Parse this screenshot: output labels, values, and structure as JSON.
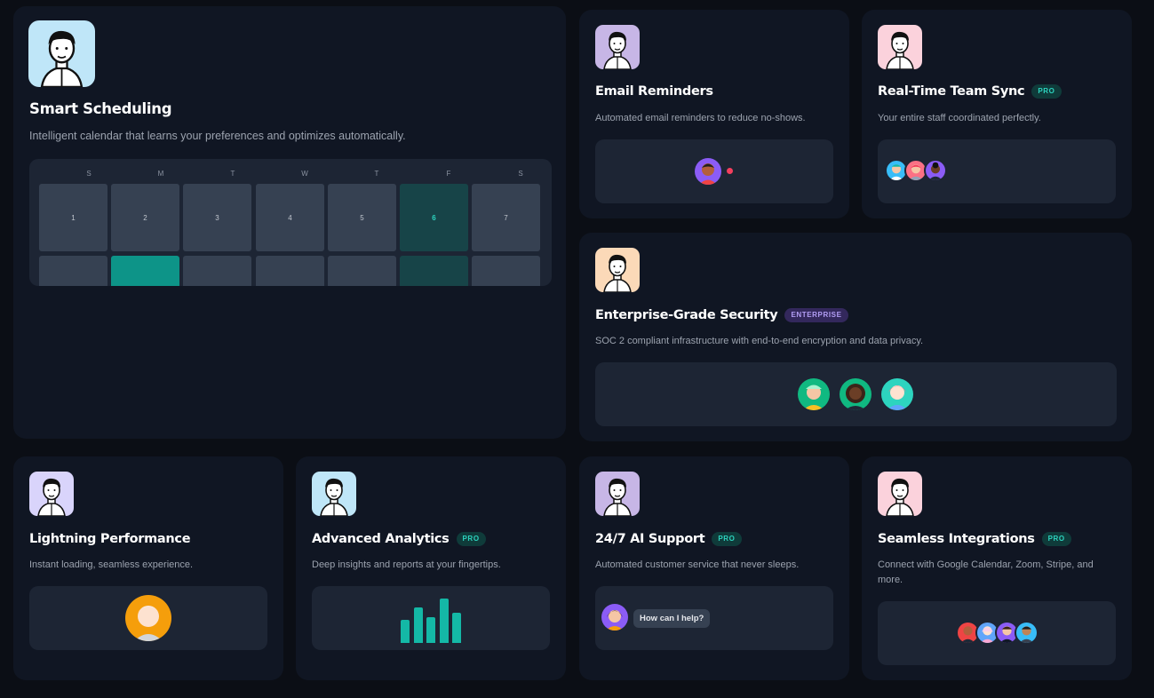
{
  "cards": {
    "smart_scheduling": {
      "title": "Smart Scheduling",
      "description": "Intelligent calendar that learns your preferences and optimizes automatically.",
      "avatar_bg": "#bfe6f8",
      "calendar": {
        "day_headers": [
          "S",
          "M",
          "T",
          "W",
          "T",
          "F",
          "S"
        ],
        "dates": [
          "1",
          "2",
          "3",
          "4",
          "5",
          "6",
          "7"
        ],
        "highlighted_date": "6"
      }
    },
    "email_reminders": {
      "title": "Email Reminders",
      "description": "Automated email reminders to reduce no-shows.",
      "avatar_bg": "#c7b6e6",
      "notification_color": "#f43f5e"
    },
    "team_sync": {
      "title": "Real-Time Team Sync",
      "badge": "PRO",
      "description": "Your entire staff coordinated perfectly.",
      "avatar_bg": "#fbd2dc"
    },
    "security": {
      "title": "Enterprise-Grade Security",
      "badge": "ENTERPRISE",
      "description": "SOC 2 compliant infrastructure with end-to-end encryption and data privacy.",
      "avatar_bg": "#fbd9b8"
    },
    "performance": {
      "title": "Lightning Performance",
      "description": "Instant loading, seamless experience.",
      "avatar_bg": "#d9d4fb"
    },
    "analytics": {
      "title": "Advanced Analytics",
      "badge": "PRO",
      "description": "Deep insights and reports at your fingertips.",
      "avatar_bg": "#bfe6f8",
      "bars": [
        0.52,
        0.8,
        0.58,
        1.0,
        0.68
      ]
    },
    "ai_support": {
      "title": "24/7 AI Support",
      "badge": "PRO",
      "description": "Automated customer service that never sleeps.",
      "avatar_bg": "#c7b6e6",
      "chat_message": "How can I help?"
    },
    "integrations": {
      "title": "Seamless Integrations",
      "badge": "PRO",
      "description": "Connect with Google Calendar, Zoom, Stripe, and more.",
      "avatar_bg": "#fbd2dc"
    }
  },
  "colors": {
    "accent": "#14b8a6",
    "card_bg": "#101623",
    "panel_bg": "#1d2534",
    "page_bg": "#0b0e15"
  }
}
